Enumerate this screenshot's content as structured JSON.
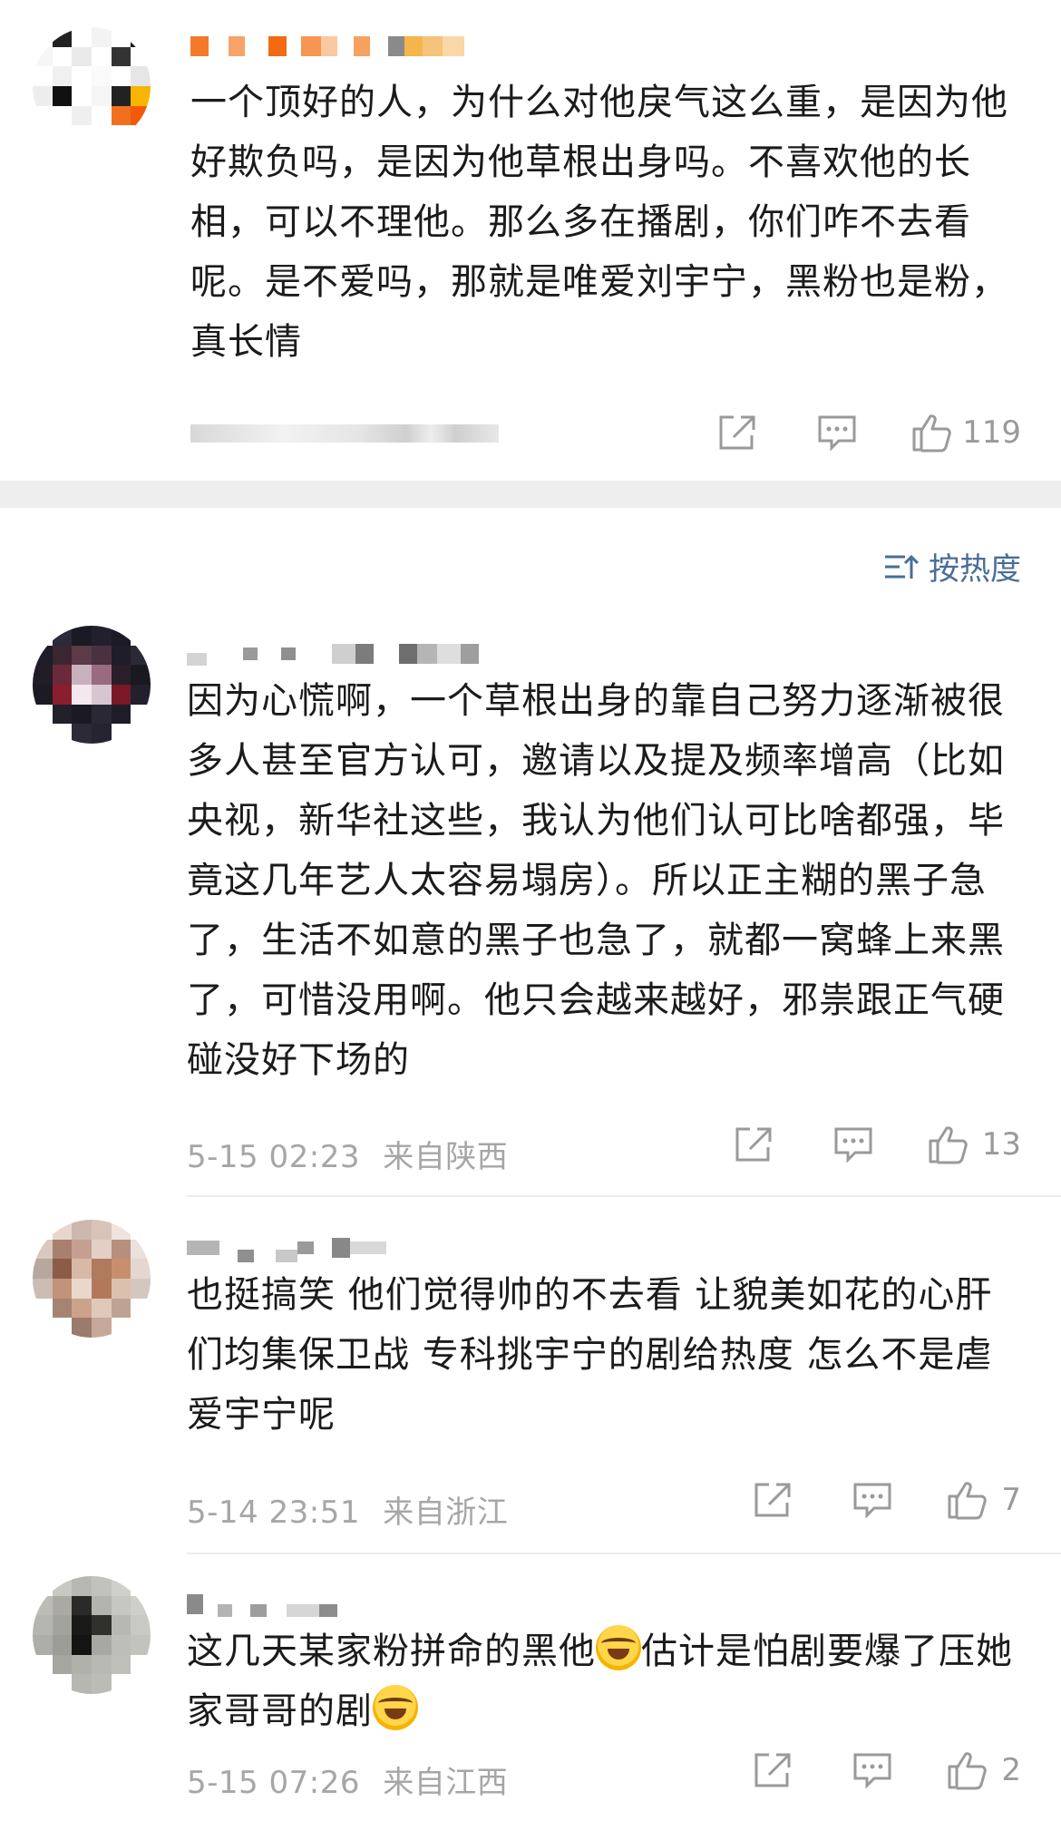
{
  "top_comment": {
    "text": "一个顶好的人，为什么对他戾气这么重，是因为他好欺负吗，是因为他草根出身吗。不喜欢他的长相，可以不理他。那么多在播剧，你们咋不去看呢。是不爱吗，那就是唯爱刘宇宁，黑粉也是粉，真长情",
    "likes": "119",
    "icons": {
      "share": "share-icon",
      "reply": "comment-icon",
      "like": "thumbs-up-icon"
    }
  },
  "sort": {
    "label": "按热度",
    "icon": "sort-icon"
  },
  "comments": [
    {
      "text": "因为心慌啊，一个草根出身的靠自己努力逐渐被很多人甚至官方认可，邀请以及提及频率增高（比如央视，新华社这些，我认为他们认可比啥都强，毕竟这几年艺人太容易塌房）。所以正主糊的黑子急了，生活不如意的黑子也急了，就都一窝蜂上来黑了，可惜没用啊。他只会越来越好，邪祟跟正气硬碰没好下场的",
      "time": "5-15 02:23",
      "location": "来自陕西",
      "likes": "13"
    },
    {
      "text": "也挺搞笑 他们觉得帅的不去看 让貌美如花的心肝们均集保卫战 专科挑宇宁的剧给热度 怎么不是虐爱宇宁呢",
      "time": "5-14 23:51",
      "location": "来自浙江",
      "likes": "7"
    },
    {
      "text_a": "这几天某家粉拼命的黑他",
      "text_b": "估计是怕剧要爆了压她家哥哥的剧",
      "emoji_name": "laughing-tears-emoji",
      "time": "5-15 07:26",
      "location": "来自江西",
      "likes": "2"
    }
  ],
  "colors": {
    "accent": "#4a6d99",
    "meta": "#a6a6a6",
    "separator": "#eeeeee"
  }
}
